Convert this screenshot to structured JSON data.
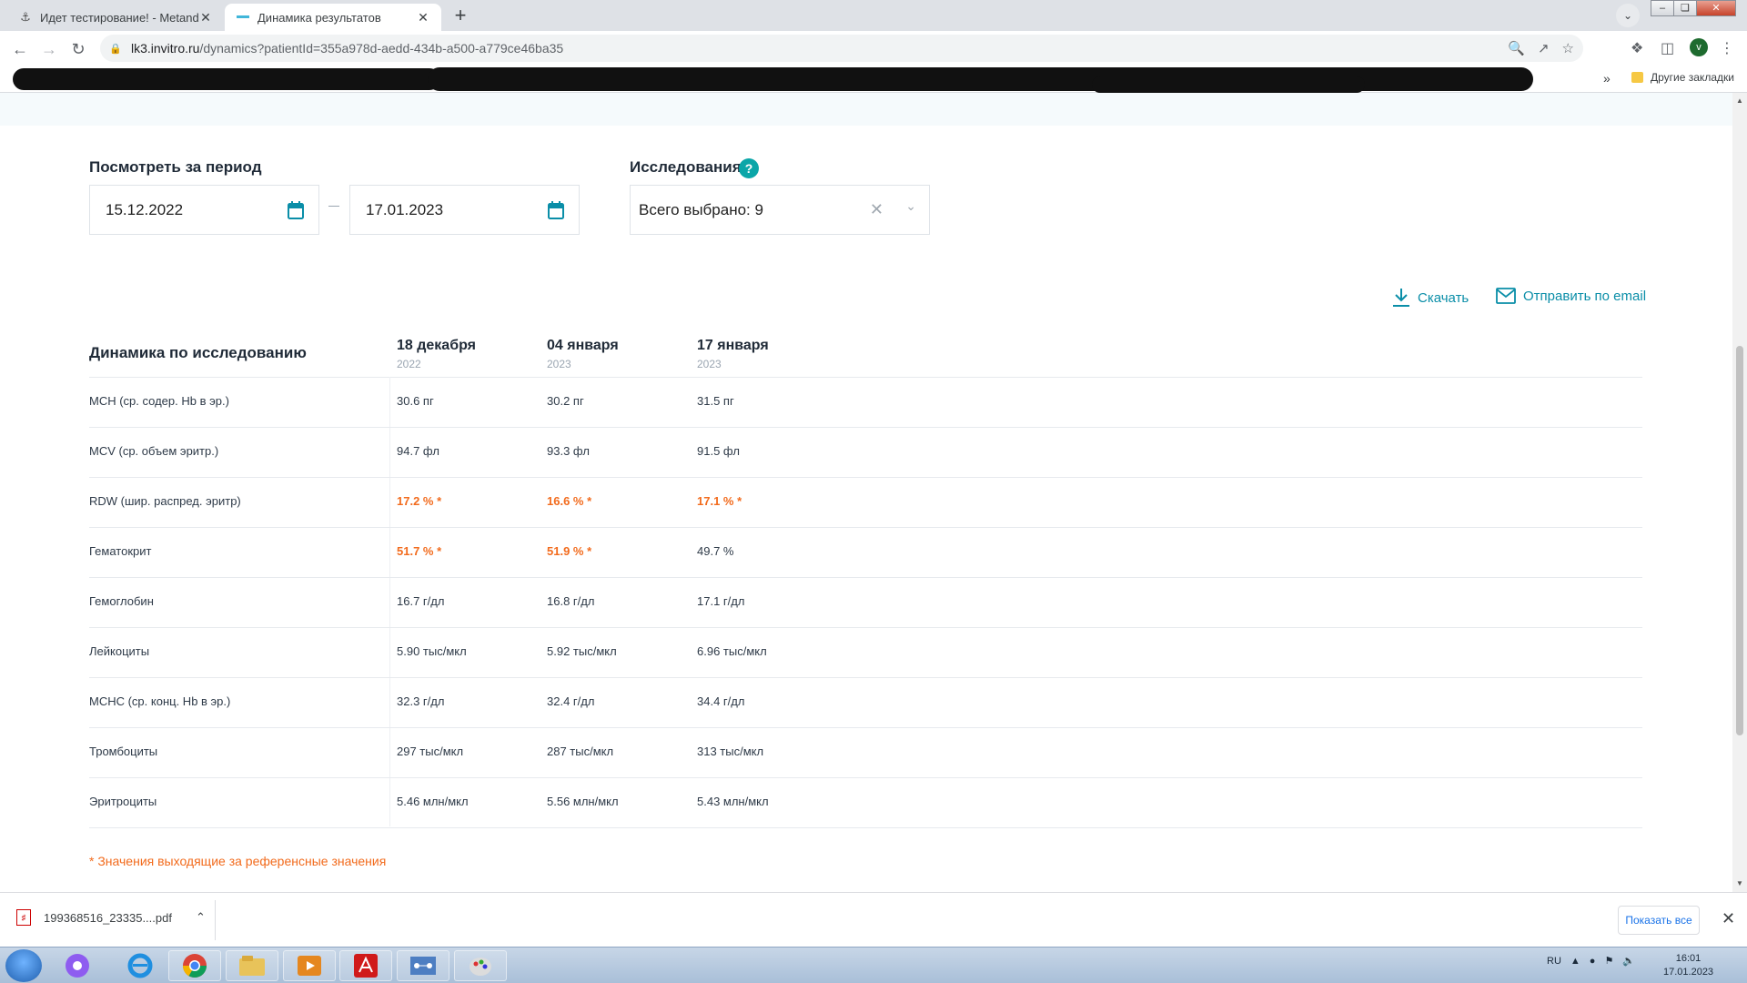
{
  "browser": {
    "tabs": [
      {
        "title": "Идет тестирование! - Metandien",
        "active": false
      },
      {
        "title": "Динамика результатов",
        "active": true
      }
    ],
    "url_host": "lk3.invitro.ru",
    "url_path": "/dynamics?patientId=355a978d-aedd-434b-a500-a779ce46ba35",
    "avatar_letter": "v",
    "bookmarks_other": "Другие закладки",
    "bookmarks_more": "»"
  },
  "filters": {
    "period_label": "Посмотреть за период",
    "date_from": "15.12.2022",
    "date_to": "17.01.2023",
    "studies_label": "Исследования",
    "help_symbol": "?",
    "studies_value": "Всего выбрано: 9"
  },
  "actions": {
    "download": "Скачать",
    "email": "Отправить по email"
  },
  "table": {
    "title": "Динамика по исследованию",
    "columns": [
      {
        "date": "18 декабря",
        "year": "2022"
      },
      {
        "date": "04 января",
        "year": "2023"
      },
      {
        "date": "17 января",
        "year": "2023"
      }
    ],
    "rows": [
      {
        "name": "MCH (ср. содер. Hb в эр.)",
        "values": [
          "30.6 пг",
          "30.2 пг",
          "31.5 пг"
        ],
        "abnormal": [
          false,
          false,
          false
        ]
      },
      {
        "name": "MCV (ср. объем эритр.)",
        "values": [
          "94.7 фл",
          "93.3 фл",
          "91.5 фл"
        ],
        "abnormal": [
          false,
          false,
          false
        ]
      },
      {
        "name": "RDW (шир. распред. эритр)",
        "values": [
          "17.2 % *",
          "16.6 % *",
          "17.1 % *"
        ],
        "abnormal": [
          true,
          true,
          true
        ]
      },
      {
        "name": "Гематокрит",
        "values": [
          "51.7 % *",
          "51.9 % *",
          "49.7 %"
        ],
        "abnormal": [
          true,
          true,
          false
        ]
      },
      {
        "name": "Гемоглобин",
        "values": [
          "16.7 г/дл",
          "16.8 г/дл",
          "17.1 г/дл"
        ],
        "abnormal": [
          false,
          false,
          false
        ]
      },
      {
        "name": "Лейкоциты",
        "values": [
          "5.90 тыс/мкл",
          "5.92 тыс/мкл",
          "6.96 тыс/мкл"
        ],
        "abnormal": [
          false,
          false,
          false
        ]
      },
      {
        "name": "MCHC (ср. конц. Hb в эр.)",
        "values": [
          "32.3 г/дл",
          "32.4 г/дл",
          "34.4 г/дл"
        ],
        "abnormal": [
          false,
          false,
          false
        ]
      },
      {
        "name": "Тромбоциты",
        "values": [
          "297 тыс/мкл",
          "287 тыс/мкл",
          "313 тыс/мкл"
        ],
        "abnormal": [
          false,
          false,
          false
        ]
      },
      {
        "name": "Эритроциты",
        "values": [
          "5.46 млн/мкл",
          "5.56 млн/мкл",
          "5.43 млн/мкл"
        ],
        "abnormal": [
          false,
          false,
          false
        ]
      }
    ],
    "footnote": "* Значения выходящие за референсные значения"
  },
  "downloads": {
    "file": "199368516_23335....pdf",
    "show_all": "Показать все"
  },
  "taskbar": {
    "lang": "RU",
    "time": "16:01",
    "date": "17.01.2023"
  },
  "colors": {
    "accent": "#0a8ea8",
    "help_badge": "#0aa6a8",
    "abnormal": "#f26b1d"
  }
}
